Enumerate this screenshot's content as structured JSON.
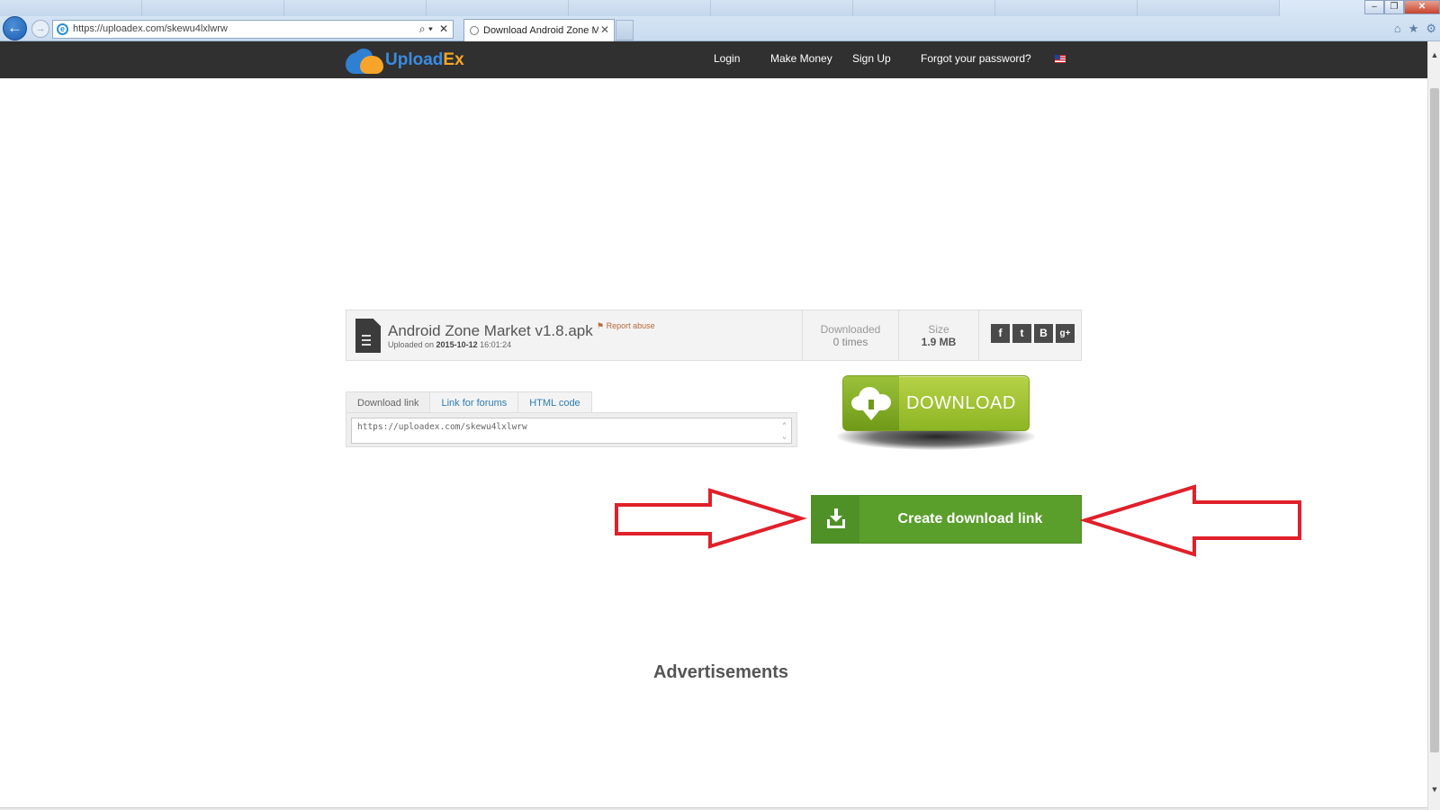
{
  "browser": {
    "address_url": "https://uploadex.com/skewu4lxlwrw",
    "active_tab_title": "Download Android Zone M...",
    "back_symbol": "←",
    "forward_symbol": "→",
    "search_symbol": "⌕ ▾",
    "stop_symbol": "✕",
    "tab_close_symbol": "✕",
    "window_buttons": [
      "–",
      "❐",
      "✕"
    ],
    "toolbar_icons": [
      "home-icon",
      "favorites-star-icon",
      "settings-gear-icon"
    ],
    "toolbar_symbols": [
      "⌂",
      "★",
      "⚙"
    ]
  },
  "site": {
    "logo_part1": "Upload",
    "logo_part2": "Ex",
    "nav": {
      "login": "Login",
      "make_money": "Make Money",
      "sign_up": "Sign Up",
      "forgot": "Forgot your password?"
    }
  },
  "file": {
    "name": "Android Zone Market v1.8.apk",
    "report": "⚑ Report abuse",
    "uploaded_prefix": "Uploaded on ",
    "uploaded_date": "2015-10-12",
    "uploaded_time": " 16:01:24",
    "downloaded_label": "Downloaded",
    "downloaded_value": "0 times",
    "size_label": "Size",
    "size_value": "1.9 MB",
    "socials": [
      "f",
      "t",
      "B",
      "g+"
    ]
  },
  "link_tabs": {
    "download_link": "Download link",
    "forums": "Link for forums",
    "html": "HTML code",
    "url": "https://uploadex.com/skewu4lxlwrw"
  },
  "download_button": {
    "label": "DOWNLOAD"
  },
  "create_button": {
    "label": "Create download link"
  },
  "ads": {
    "heading": "Advertisements"
  },
  "colors": {
    "header_bg": "#303030",
    "download_green": "#8db524",
    "create_green": "#5a9e2c",
    "annotation_red": "#e0202a",
    "logo_blue": "#3a8be0",
    "logo_orange": "#f7a52a"
  }
}
